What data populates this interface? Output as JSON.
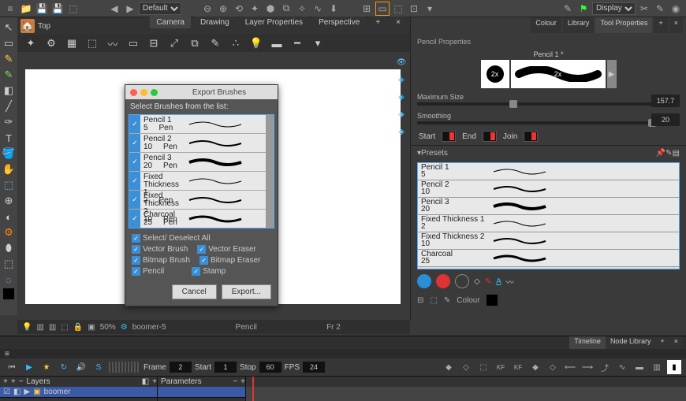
{
  "topbar": {
    "workspace": "Default",
    "display": "Display"
  },
  "camera": {
    "view": "Top",
    "tabs": [
      "Camera",
      "Drawing",
      "Layer Properties",
      "Perspective"
    ]
  },
  "status": {
    "zoom": "50%",
    "scene": "boomer-5",
    "tool": "Pencil",
    "frame": "Fr 2"
  },
  "right": {
    "tabs": [
      "Colour",
      "Library",
      "Tool Properties"
    ],
    "title": "Pencil Properties",
    "preview_label": "Pencil 1 *",
    "preview_zoom": "2x",
    "max_size": {
      "label": "Maximum Size",
      "value": "157.7"
    },
    "smoothing": {
      "label": "Smoothing",
      "value": "20"
    },
    "caps": {
      "start": "Start",
      "end": "End",
      "join": "Join"
    },
    "presets_hdr": "Presets",
    "presets": [
      {
        "name": "Pencil 1",
        "size": "5"
      },
      {
        "name": "Pencil 2",
        "size": "10"
      },
      {
        "name": "Pencil 3",
        "size": "20"
      },
      {
        "name": "Fixed Thickness 1",
        "size": "2"
      },
      {
        "name": "Fixed Thickness 2",
        "size": "10"
      },
      {
        "name": "Charcoal",
        "size": "25"
      }
    ],
    "colour_label": "Colour"
  },
  "modal": {
    "title": "Export Brushes",
    "subtitle": "Select Brushes from the list:",
    "brushes": [
      {
        "name": "Pencil 1",
        "size": "5",
        "type": "Pen"
      },
      {
        "name": "Pencil 2",
        "size": "10",
        "type": "Pen"
      },
      {
        "name": "Pencil 3",
        "size": "20",
        "type": "Pen"
      },
      {
        "name": "Fixed Thickness 1",
        "size": "2",
        "type": "Pen"
      },
      {
        "name": "Fixed Thickness 2",
        "size": "10",
        "type": "Pen"
      },
      {
        "name": "Charcoal",
        "size": "25",
        "type": "Pen"
      }
    ],
    "select_all": "Select/ Deselect All",
    "opts": {
      "vector_brush": "Vector Brush",
      "vector_eraser": "Vector Eraser",
      "bitmap_brush": "Bitmap Brush",
      "bitmap_eraser": "Bitmap Eraser",
      "pencil": "Pencil",
      "stamp": "Stamp"
    },
    "cancel": "Cancel",
    "export": "Export..."
  },
  "timeline": {
    "tabs": [
      "Timeline",
      "Node Library"
    ],
    "frame_lbl": "Frame",
    "frame": "2",
    "start_lbl": "Start",
    "start": "1",
    "stop_lbl": "Stop",
    "stop": "60",
    "fps_lbl": "FPS",
    "fps": "24",
    "layers_hdr": "Layers",
    "params_hdr": "Parameters",
    "layer1": "boomer"
  }
}
